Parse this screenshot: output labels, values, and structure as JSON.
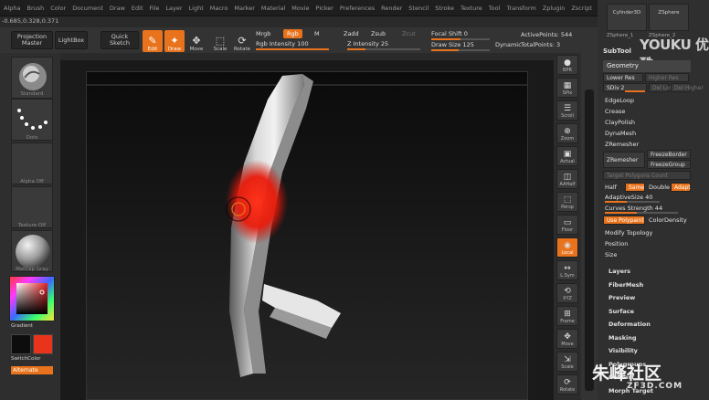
{
  "menu": [
    "Alpha",
    "Brush",
    "Color",
    "Document",
    "Draw",
    "Edit",
    "File",
    "Layer",
    "Light",
    "Macro",
    "Marker",
    "Material",
    "Movie",
    "Picker",
    "Preferences",
    "Render",
    "Stencil",
    "Stroke",
    "Texture",
    "Tool",
    "Transform",
    "Zplugin",
    "Zscript"
  ],
  "coords": "-0.685,0.328,0.371",
  "toolbar": {
    "projection_master": "Projection Master",
    "lightbox": "LightBox",
    "quick_sketch": "Quick Sketch",
    "edit": "Edit",
    "draw": "Draw",
    "move": "Move",
    "scale": "Scale",
    "rotate": "Rotate",
    "mrgb": "Mrgb",
    "rgb": "Rgb",
    "m": "M",
    "rgb_intensity_label": "Rgb Intensity",
    "rgb_intensity_value": "100",
    "zadd": "Zadd",
    "zsub": "Zsub",
    "zcut": "Zcut",
    "z_intensity_label": "Z Intensity",
    "z_intensity_value": "25",
    "focal_shift_label": "Focal Shift",
    "focal_shift_value": "0",
    "draw_size_label": "Draw Size",
    "draw_size_value": "125",
    "dynamic": "Dynamic",
    "active_points_label": "ActivePoints:",
    "active_points_value": "544",
    "total_points_label": "TotalPoints:",
    "total_points_value": "3"
  },
  "left": {
    "brush": "Standard",
    "stroke": "Dots",
    "alpha": "Alpha Off",
    "texture": "Texture Off",
    "material": "MatCap Gray",
    "gradient": "Gradient",
    "switch_color": "SwitchColor",
    "alternate": "Alternate"
  },
  "right_tools": [
    "BPR",
    "SPix",
    "Scroll",
    "Zoom",
    "Actual",
    "AAHalf",
    "Persp",
    "Floor",
    "Local",
    "L.Sym",
    "XYZ",
    "Frame",
    "Move",
    "Scale",
    "Rotate"
  ],
  "subtool": {
    "top_thumb_1": "Cylinder3D",
    "top_thumb_2": "ZSphere",
    "top_thumb_3": "ZSphere_1",
    "top_thumb_4": "ZSphere_2",
    "header": "SubTool",
    "geometry": "Geometry",
    "lower_res": "Lower Res",
    "higher_res": "Higher Res",
    "sdiv": "SDiv 2",
    "del_lower": "Del Lower",
    "del_higher": "Del Higher",
    "edge_loop": "EdgeLoop",
    "crease": "Crease",
    "clay_polish": "ClayPolish",
    "dyna_mesh": "DynaMesh",
    "zremesher": "ZRemesher",
    "zremesher_btn": "ZRemesher",
    "freeze_borders": "FreezeBorder",
    "freeze_groups": "FreezeGroup",
    "target_polygons": "Target Polygons Count",
    "half": "Half",
    "same": "Same",
    "double": "Double",
    "adapt": "Adapt",
    "adaptive_size": "AdaptiveSize 40",
    "curves_strength": "Curves Strength 44",
    "use_polypaint": "Use Polypaint",
    "color_density": "ColorDensity",
    "modify_topology": "Modify Topology",
    "position": "Position",
    "size": "Size",
    "sections": [
      "Layers",
      "FiberMesh",
      "Preview",
      "Surface",
      "Deformation",
      "Masking",
      "Visibility",
      "Polygroups",
      "Contact",
      "Morph Target"
    ]
  },
  "watermark": {
    "top": "YOUKU 优酷",
    "bottom": "朱峰社区",
    "url": "ZF3D.COM"
  },
  "colors": {
    "accent": "#e8731c",
    "primary_color": "#111111",
    "secondary_color": "#e8341c"
  }
}
